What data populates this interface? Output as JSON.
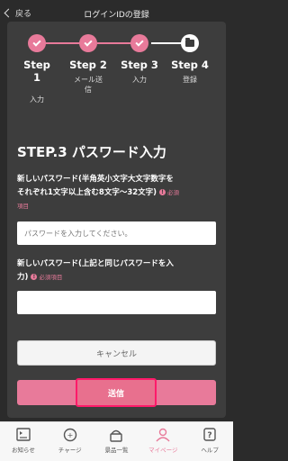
{
  "header": {
    "back_label": "戻る",
    "title": "ログインIDの登録"
  },
  "steps": [
    {
      "label_line1": "Step",
      "label_line2": "1",
      "sub": "入力",
      "state": "done"
    },
    {
      "label_line1": "Step 2",
      "label_line2": "",
      "sub_line1": "メール送",
      "sub_line2": "信",
      "state": "done"
    },
    {
      "label_line1": "Step 3",
      "label_line2": "",
      "sub": "入力",
      "state": "done"
    },
    {
      "label_line1": "Step 4",
      "label_line2": "",
      "sub": "登録",
      "state": "todo"
    }
  ],
  "form": {
    "heading": "STEP.3 パスワード入力",
    "field1": {
      "label_line1": "新しいパスワード(半角英小文字大文字数字を",
      "label_line2": "それぞれ1文字以上含む8文字〜32文字)",
      "required": "必",
      "required_text_a": "須",
      "required_text_b": "項目",
      "placeholder": "パスワードを入力してください。"
    },
    "field2": {
      "label_line1": "新しいパスワード(上記と同じパスワードを入",
      "label_line2": "力)",
      "required": "!",
      "required_text": "必須項目",
      "placeholder": ""
    },
    "cancel_label": "キャンセル",
    "send_label": "送信"
  },
  "tabbar": [
    {
      "label": "お知らせ",
      "icon": "news-icon"
    },
    {
      "label": "チャージ",
      "icon": "charge-icon"
    },
    {
      "label": "景品一覧",
      "icon": "gift-icon"
    },
    {
      "label": "マイページ",
      "icon": "person-icon",
      "active": true
    },
    {
      "label": "ヘルプ",
      "icon": "help-icon"
    }
  ],
  "colors": {
    "accent": "#e87a9a",
    "highlight": "#ff1a6a",
    "card": "#3d3d3d",
    "background": "#2b2b2b"
  }
}
